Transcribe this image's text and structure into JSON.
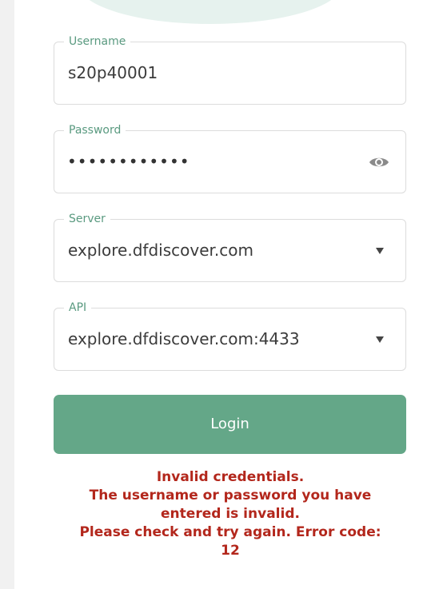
{
  "form": {
    "username": {
      "label": "Username",
      "value": "s20p40001"
    },
    "password": {
      "label": "Password",
      "masked_value": "••••••••••••",
      "toggle_icon": "eye-icon"
    },
    "server": {
      "label": "Server",
      "selected": "explore.dfdiscover.com",
      "dropdown_icon": "caret-down-icon"
    },
    "api": {
      "label": "API",
      "selected": "explore.dfdiscover.com:4433",
      "dropdown_icon": "caret-down-icon"
    },
    "login_label": "Login"
  },
  "error": {
    "line1": "Invalid credentials.",
    "line2": "The username or password you have",
    "line3": "entered is invalid.",
    "line4": "Please check and try again. Error code:",
    "line5": "12"
  },
  "colors": {
    "accent": "#64a788",
    "label": "#5a9a80",
    "error": "#b3271c"
  }
}
